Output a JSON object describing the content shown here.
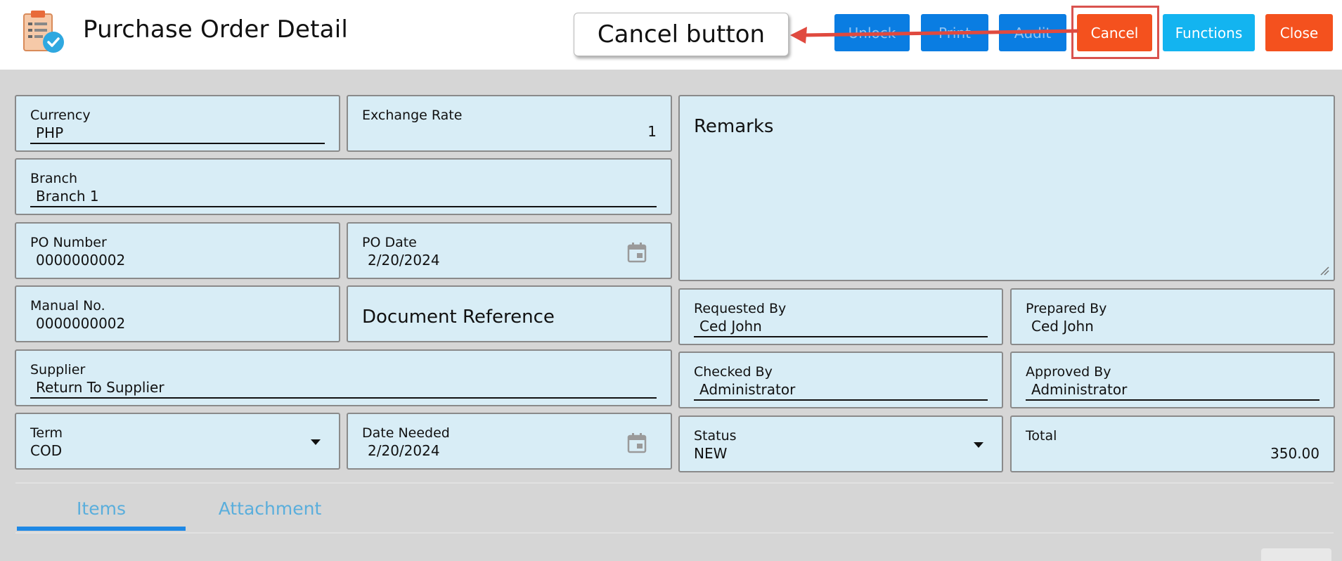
{
  "header": {
    "title": "Purchase Order Detail",
    "app_icon": "clipboard-check-icon"
  },
  "toolbar": {
    "unlock_label": "Unlock",
    "print_label": "Print",
    "audit_label": "Audit",
    "cancel_label": "Cancel",
    "functions_label": "Functions",
    "close_label": "Close"
  },
  "annotation": {
    "callout_text": "Cancel button",
    "highlight_color": "#d9534f"
  },
  "colors": {
    "blue": "#0a7de2",
    "cyan": "#13b4f0",
    "orange": "#f4511e",
    "field_bg": "#d8edf6"
  },
  "form": {
    "currency": {
      "label": "Currency",
      "value": "PHP"
    },
    "exchange_rate": {
      "label": "Exchange Rate",
      "value": "1"
    },
    "branch": {
      "label": "Branch",
      "value": "Branch 1"
    },
    "po_number": {
      "label": "PO Number",
      "value": "0000000002"
    },
    "po_date": {
      "label": "PO Date",
      "value": "2/20/2024"
    },
    "manual_no": {
      "label": "Manual No.",
      "value": "0000000002"
    },
    "document_reference": {
      "label": "Document Reference"
    },
    "supplier": {
      "label": "Supplier",
      "value": "Return To Supplier"
    },
    "term": {
      "label": "Term",
      "value": "COD"
    },
    "date_needed": {
      "label": "Date Needed",
      "value": "2/20/2024"
    },
    "remarks": {
      "label": "Remarks"
    },
    "requested_by": {
      "label": "Requested By",
      "value": "Ced John"
    },
    "prepared_by": {
      "label": "Prepared By",
      "value": "Ced John"
    },
    "checked_by": {
      "label": "Checked By",
      "value": "Administrator"
    },
    "approved_by": {
      "label": "Approved By",
      "value": "Administrator"
    },
    "status": {
      "label": "Status",
      "value": "NEW"
    },
    "total": {
      "label": "Total",
      "value": "350.00"
    }
  },
  "tabs": [
    {
      "label": "Items",
      "active": true
    },
    {
      "label": "Attachment",
      "active": false
    }
  ]
}
